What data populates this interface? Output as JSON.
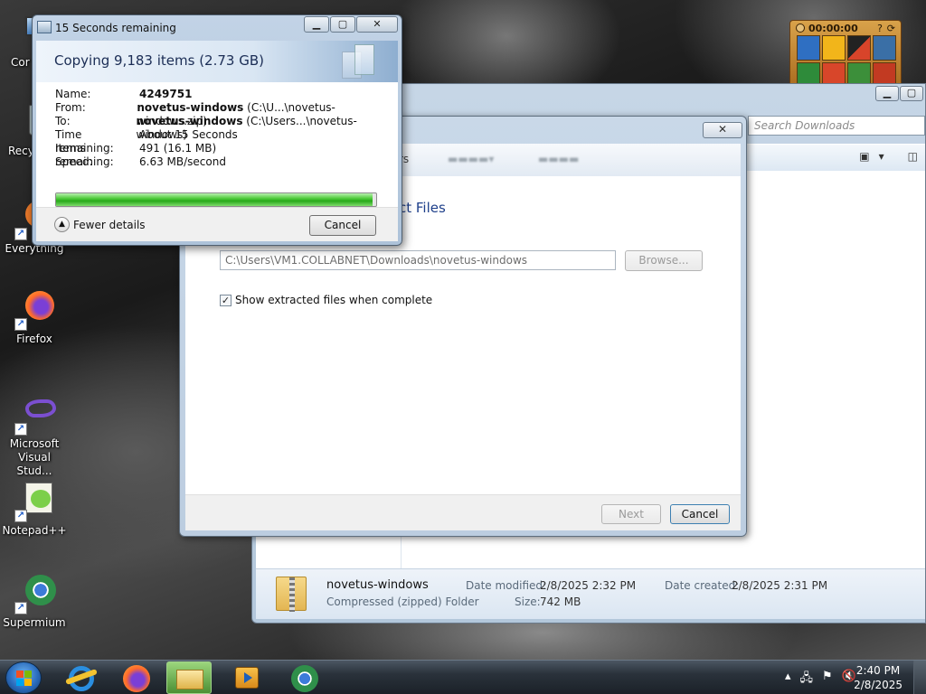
{
  "desktop": {
    "icons": [
      {
        "label": "Cor"
      },
      {
        "label": "Recy"
      },
      {
        "label": "Everything"
      },
      {
        "label": "Firefox"
      },
      {
        "label": "Microsoft Visual Stud..."
      },
      {
        "label": "Notepad++"
      },
      {
        "label": "Supermium"
      }
    ]
  },
  "gadget": {
    "time": "00:00:00"
  },
  "explorer": {
    "search_placeholder": "Search Downloads",
    "details": {
      "name": "novetus-windows",
      "type": "Compressed (zipped) Folder",
      "date_modified_label": "Date modified:",
      "date_modified": "2/8/2025 2:32 PM",
      "size_label": "Size:",
      "size": "742 MB",
      "date_created_label": "Date created:",
      "date_created": "2/8/2025 2:31 PM"
    }
  },
  "wizard": {
    "heading": "ct Files",
    "nav_partial": "rs",
    "path": "C:\\Users\\VM1.COLLABNET\\Downloads\\novetus-windows",
    "browse": "Browse...",
    "checkbox_label": "Show extracted files when complete",
    "checkbox_checked": true,
    "next": "Next",
    "cancel": "Cancel"
  },
  "copy_dialog": {
    "title": "15 Seconds remaining",
    "heading": "Copying 9,183 items (2.73 GB)",
    "rows": [
      {
        "key": "Name:",
        "bold": "4249751",
        "rest": ""
      },
      {
        "key": "From:",
        "bold": "novetus-windows",
        "rest": " (C:\\U...\\novetus-windows.zip)"
      },
      {
        "key": "To:",
        "bold": "novetus-windows",
        "rest": " (C:\\Users...\\novetus-windows)"
      },
      {
        "key": "Time remaining:",
        "bold": "",
        "rest": "About 15 Seconds"
      },
      {
        "key": "Items remaining:",
        "bold": "",
        "rest": "491 (16.1 MB)"
      },
      {
        "key": "Speed:",
        "bold": "",
        "rest": "6.63 MB/second"
      }
    ],
    "progress_percent": 99,
    "fewer_details": "Fewer details",
    "cancel": "Cancel"
  },
  "taskbar": {
    "clock_time": "2:40 PM",
    "clock_date": "2/8/2025"
  }
}
